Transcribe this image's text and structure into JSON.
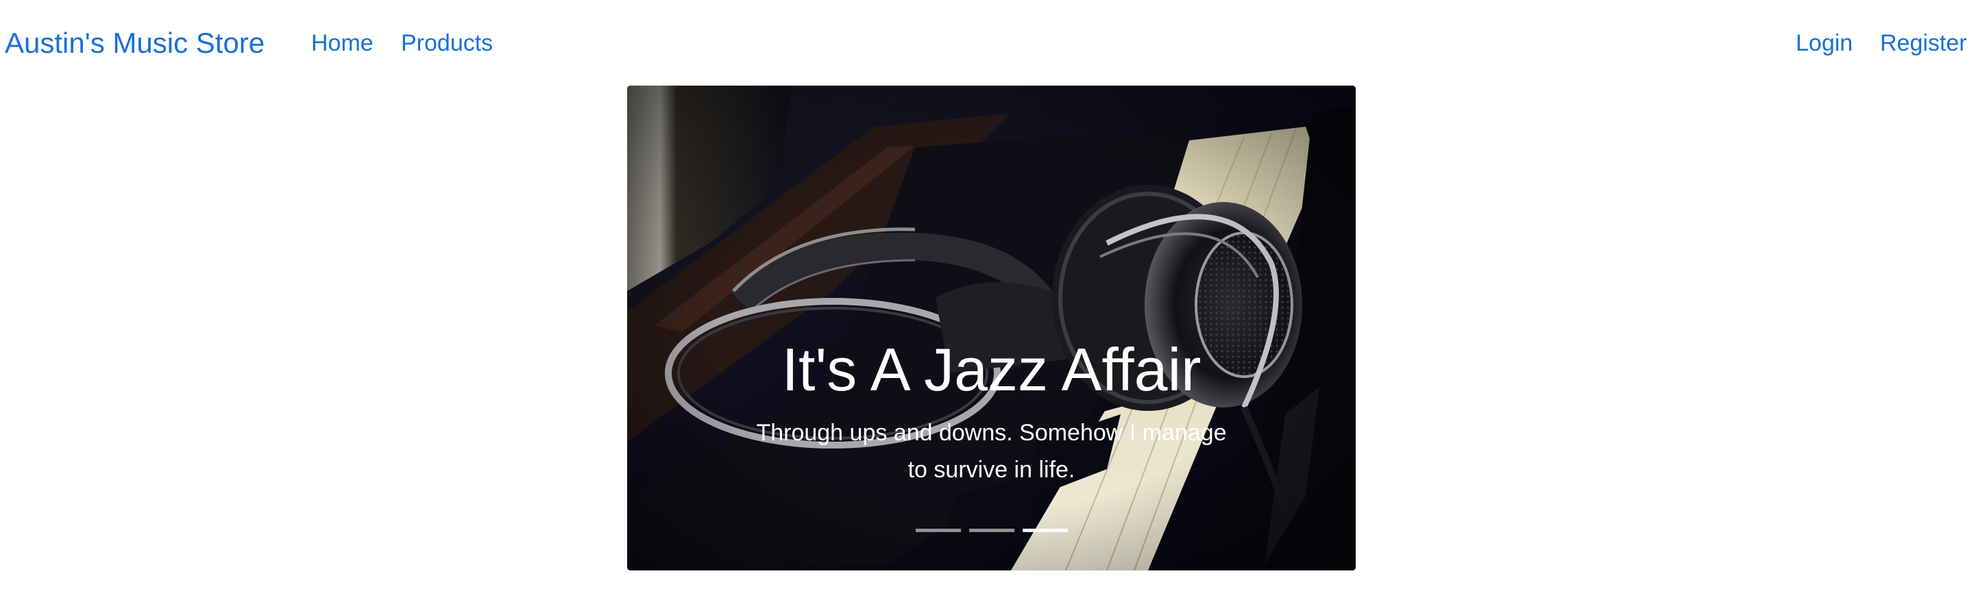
{
  "navbar": {
    "brand": "Austin's Music Store",
    "links": [
      {
        "label": "Home"
      },
      {
        "label": "Products"
      }
    ],
    "auth": [
      {
        "label": "Login"
      },
      {
        "label": "Register"
      }
    ],
    "link_color": "#1a6fd9"
  },
  "carousel": {
    "slides": [
      {
        "title": "It's A Jazz Affair",
        "text": "Through ups and downs. Somehow I manage to survive in life.",
        "image": "headphones-on-piano-keys"
      }
    ],
    "indicators": [
      {
        "active": false
      },
      {
        "active": false
      },
      {
        "active": true
      }
    ],
    "active_index": 2
  }
}
